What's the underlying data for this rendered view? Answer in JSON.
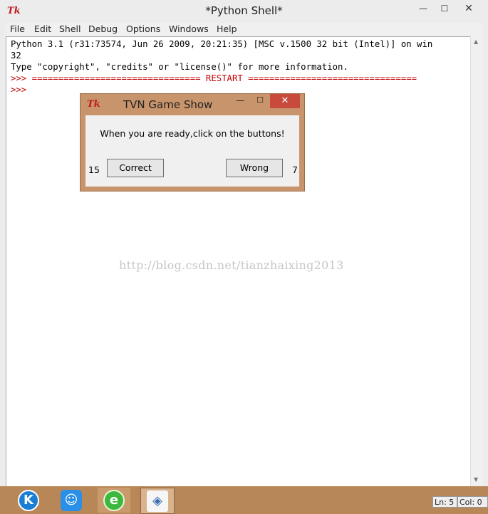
{
  "window": {
    "title": "*Python Shell*",
    "logo": "Tk",
    "minimize_icon": "minimize-icon",
    "maximize_icon": "maximize-icon",
    "close_icon": "close-icon"
  },
  "menubar": {
    "items": [
      "File",
      "Edit",
      "Shell",
      "Debug",
      "Options",
      "Windows",
      "Help"
    ]
  },
  "editor": {
    "lines": [
      "Python 3.1 (r31:73574, Jun 26 2009, 20:21:35) [MSC v.1500 32 bit (Intel)] on win",
      "32",
      "Type \"copyright\", \"credits\" or \"license()\" for more information.",
      ">>> ================================ RESTART ================================",
      ">>> "
    ]
  },
  "watermark": "http://blog.csdn.net/tianzhaixing2013",
  "dialog": {
    "logo": "Tk",
    "title": "TVN Game Show",
    "message": "When you are ready,click on the buttons!",
    "correct_count": "15",
    "correct_label": "Correct",
    "wrong_label": "Wrong",
    "wrong_count": "7"
  },
  "taskbar": {
    "apps": [
      "kugou-icon",
      "qq-icon",
      "browser-icon",
      "python-idle-icon"
    ]
  },
  "status": {
    "line": "Ln: 5",
    "col": "Col: 0"
  },
  "colors": {
    "dialog_frame": "#c8946b",
    "close_button": "#c74a3c",
    "prompt": "#c00000",
    "taskbar": "#b88757"
  }
}
